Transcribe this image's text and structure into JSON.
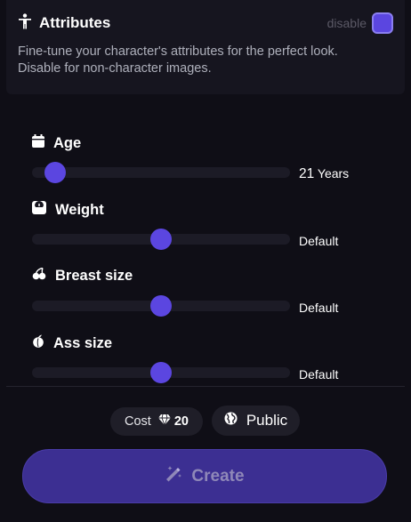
{
  "header": {
    "title": "Attributes",
    "disable_label": "disable",
    "icon": "person-arms-out-icon"
  },
  "description": "Fine-tune your character's attributes for the perfect look. Disable for non-character images.",
  "attributes": [
    {
      "label": "Age",
      "icon": "calendar-icon",
      "value_number": "21",
      "value_unit": "Years",
      "level": 0.09
    },
    {
      "label": "Weight",
      "icon": "scale-icon",
      "value": "Default",
      "level": 0.5
    },
    {
      "label": "Breast size",
      "icon": "cherries-icon",
      "value": "Default",
      "level": 0.5
    },
    {
      "label": "Ass size",
      "icon": "peach-icon",
      "value": "Default",
      "level": 0.5
    }
  ],
  "footer": {
    "cost_label": "Cost",
    "cost_value": "20",
    "cost_icon": "diamond-icon",
    "visibility_label": "Public",
    "visibility_icon": "globe-icon",
    "create_label": "Create",
    "create_icon": "magic-wand-icon"
  },
  "colors": {
    "accent": "#5b46e0",
    "background": "#0f0e16",
    "panel": "#16151f",
    "create_button": "#3c2f92"
  }
}
